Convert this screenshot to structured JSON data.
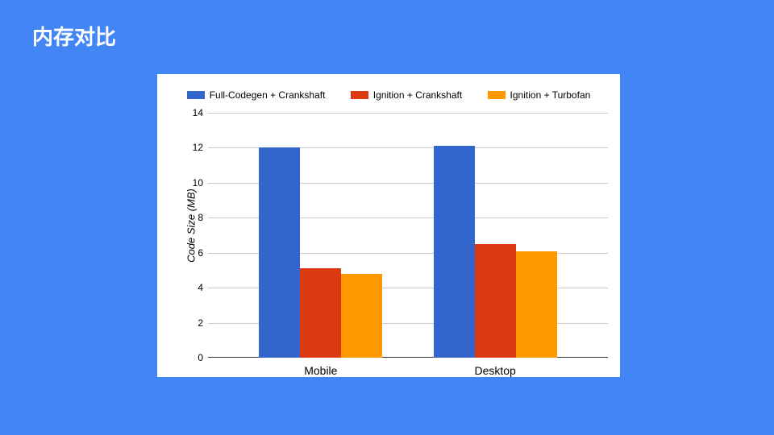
{
  "slide": {
    "title": "内存对比"
  },
  "chart_data": {
    "type": "bar",
    "ylabel": "Code Size (MB)",
    "xlabel": "",
    "ylim": [
      0,
      14
    ],
    "yticks": [
      0,
      2,
      4,
      6,
      8,
      10,
      12,
      14
    ],
    "categories": [
      "Mobile",
      "Desktop"
    ],
    "series": [
      {
        "name": "Full-Codegen + Crankshaft",
        "color": "#3366cc",
        "values": [
          12.0,
          12.1
        ]
      },
      {
        "name": "Ignition + Crankshaft",
        "color": "#dc3912",
        "values": [
          5.1,
          6.5
        ]
      },
      {
        "name": "Ignition + Turbofan",
        "color": "#ff9900",
        "values": [
          4.8,
          6.1
        ]
      }
    ]
  }
}
